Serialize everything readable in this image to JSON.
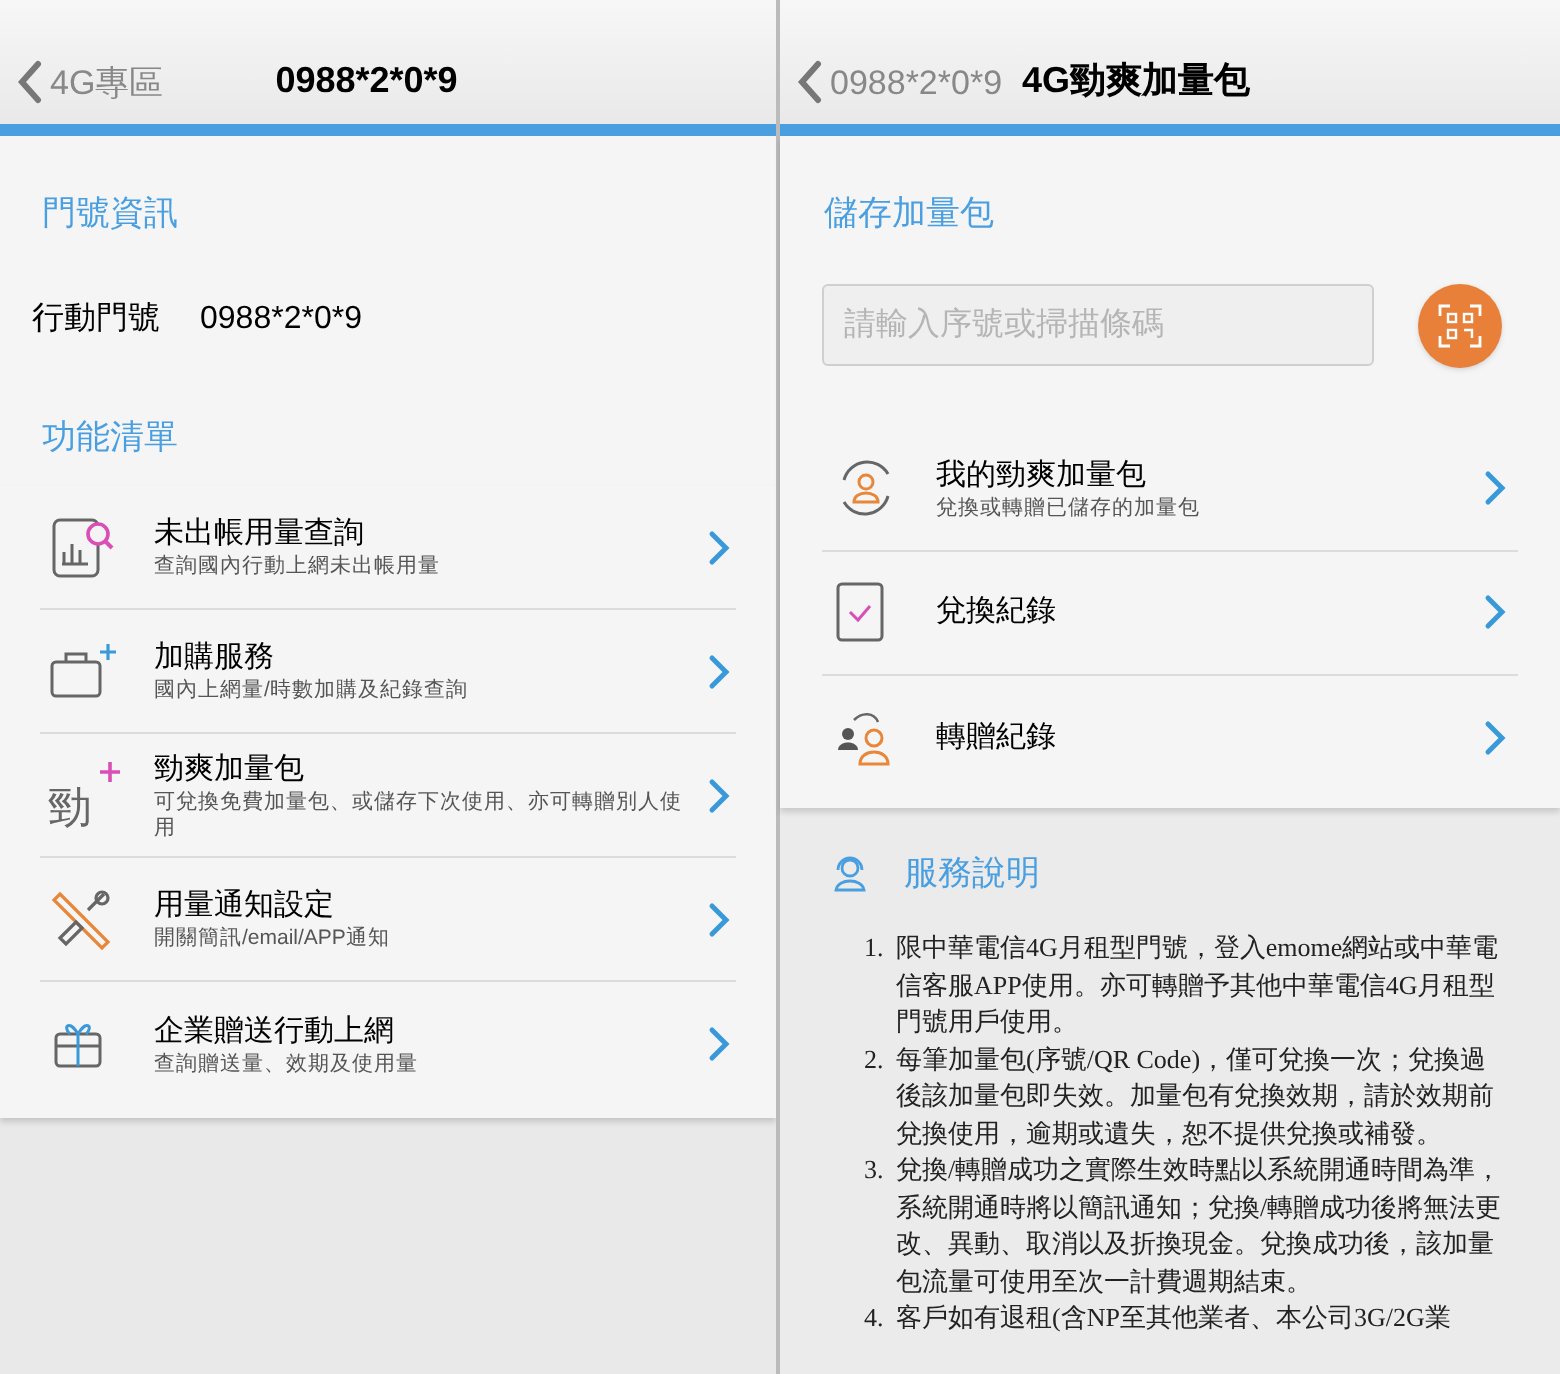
{
  "left": {
    "nav": {
      "back": "4G專區",
      "title": "0988*2*0*9"
    },
    "info_heading": "門號資訊",
    "info": {
      "label": "行動門號",
      "value": "0988*2*0*9"
    },
    "menu_heading": "功能清單",
    "menu": [
      {
        "kind": "usage",
        "title": "未出帳用量查詢",
        "subtitle": "查詢國內行動上網未出帳用量"
      },
      {
        "kind": "addon",
        "title": "加購服務",
        "subtitle": "國內上網量/時數加購及紀錄查詢"
      },
      {
        "kind": "booster",
        "icon_text": "勁",
        "title": "勁爽加量包",
        "subtitle": "可兌換免費加量包、或儲存下次使用、亦可轉贈別人使用"
      },
      {
        "kind": "settings",
        "title": "用量通知設定",
        "subtitle": "開關簡訊/email/APP通知"
      },
      {
        "kind": "gift",
        "title": "企業贈送行動上網",
        "subtitle": "查詢贈送量、效期及使用量"
      }
    ]
  },
  "right": {
    "nav": {
      "back": "0988*2*0*9",
      "title": "4G勁爽加量包"
    },
    "store_heading": "儲存加量包",
    "code_field": {
      "placeholder": "請輸入序號或掃描條碼"
    },
    "menu": [
      {
        "kind": "my-pack",
        "title": "我的勁爽加量包",
        "subtitle": "兌換或轉贈已儲存的加量包"
      },
      {
        "kind": "exchange",
        "title": "兌換紀錄"
      },
      {
        "kind": "transfer",
        "title": "轉贈紀錄"
      }
    ],
    "notes_heading": "服務說明",
    "notes": [
      {
        "number": "1.",
        "text": "限中華電信4G月租型門號，登入emome網站或中華電信客服APP使用。亦可轉贈予其他中華電信4G月租型門號用戶使用。"
      },
      {
        "number": "2.",
        "text": "每筆加量包(序號/QR Code)，僅可兌換一次；兌換過後該加量包即失效。加量包有兌換效期，請於效期前兌換使用，逾期或遺失，恕不提供兌換或補發。"
      },
      {
        "number": "3.",
        "text": "兌換/轉贈成功之實際生效時點以系統開通時間為準，系統開通時將以簡訊通知；兌換/轉贈成功後將無法更改、異動、取消以及折換現金。兌換成功後，該加量包流量可使用至次一計費週期結束。"
      },
      {
        "number": "4.",
        "text": "客戶如有退租(含NP至其他業者、本公司3G/2G業"
      }
    ]
  }
}
